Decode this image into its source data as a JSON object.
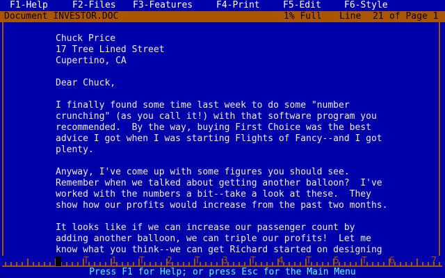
{
  "menu": [
    {
      "label": "F1-Help"
    },
    {
      "label": "F2-Files"
    },
    {
      "label": "F3-Features"
    },
    {
      "label": "F4-Print"
    },
    {
      "label": "F5-Edit"
    },
    {
      "label": "F6-Style"
    }
  ],
  "status": {
    "document": "Document INVESTOR.DOC",
    "fullness": "1% Full",
    "line_label": "Line",
    "line": "21",
    "of_page": "of Page 1"
  },
  "document_lines": [
    "Chuck Price",
    "17 Tree Lined Street",
    "Cupertino, CA",
    "",
    "Dear Chuck,",
    "",
    "I finally found some time last week to do some \"number",
    "crunching\" (as you call it!) with that software program you",
    "recommended.  By the way, buying First Choice was the best",
    "advice I got when I was starting Flights of Fancy--and I got",
    "plenty.",
    "",
    "Anyway, I've come up with some figures you should see.",
    "Remember when we talked about getting another balloon?  I've",
    "worked with the numbers a bit--take a look at these.  They",
    "show how our profits would increase from the past two months.",
    "",
    "It looks like if we can increase our passenger count by",
    "adding another balloon, we can triple our profits!  Let me",
    "know what you think--we can get Richard started on designing"
  ],
  "ruler": {
    "tab_marker": "T",
    "numbers": [
      "1",
      "2",
      "3",
      "4",
      "5",
      "6",
      "7"
    ]
  },
  "help_line": "Press F1 for Help; or press Esc for the Main Menu",
  "colors": {
    "background": "#0000aa",
    "status_bar": "#aa5500",
    "help_text": "#55ffff"
  }
}
